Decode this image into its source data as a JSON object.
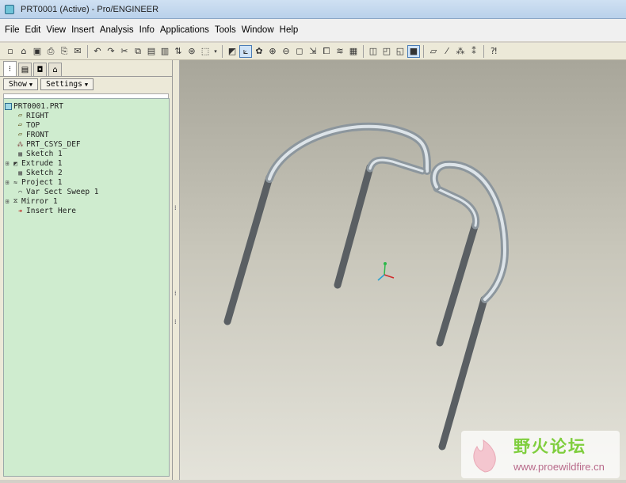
{
  "window": {
    "title": "PRT0001 (Active) - Pro/ENGINEER"
  },
  "menubar": {
    "items": [
      "File",
      "Edit",
      "View",
      "Insert",
      "Analysis",
      "Info",
      "Applications",
      "Tools",
      "Window",
      "Help"
    ]
  },
  "toolbar": {
    "buttons": [
      "new-icon",
      "open-icon",
      "save-icon",
      "print-icon",
      "print-preview-icon",
      "email-icon",
      "undo-icon",
      "redo-icon",
      "cut-icon",
      "copy-icon",
      "paste-icon",
      "paste-special-icon",
      "regenerate-icon",
      "find-icon",
      "select-box-icon",
      "repaint-icon",
      "spin-center-icon",
      "orient-mode-icon",
      "zoom-in-icon",
      "zoom-out-icon",
      "refit-icon",
      "reorient-icon",
      "saved-views-icon",
      "layers-icon",
      "view-manager-icon",
      "wireframe-icon",
      "hidden-line-icon",
      "no-hidden-icon",
      "shading-icon",
      "datum-planes-icon",
      "datum-axes-icon",
      "datum-points-icon",
      "coordinate-systems-icon",
      "context-help-icon"
    ]
  },
  "panel": {
    "tabs": [
      "model-tree-tab",
      "folder-browser-tab",
      "favorites-tab",
      "connections-tab"
    ],
    "show_label": "Show",
    "settings_label": "Settings"
  },
  "model_tree": {
    "items": [
      {
        "label": "PRT0001.PRT",
        "icon": "part-icon",
        "expandable": false,
        "indent": 0
      },
      {
        "label": "RIGHT",
        "icon": "datum-plane-icon",
        "expandable": false,
        "indent": 1
      },
      {
        "label": "TOP",
        "icon": "datum-plane-icon",
        "expandable": false,
        "indent": 1
      },
      {
        "label": "FRONT",
        "icon": "datum-plane-icon",
        "expandable": false,
        "indent": 1
      },
      {
        "label": "PRT_CSYS_DEF",
        "icon": "csys-icon",
        "expandable": false,
        "indent": 1
      },
      {
        "label": "Sketch 1",
        "icon": "sketch-icon",
        "expandable": false,
        "indent": 1
      },
      {
        "label": "Extrude 1",
        "icon": "extrude-icon",
        "expandable": true,
        "indent": 1
      },
      {
        "label": "Sketch 2",
        "icon": "sketch-icon",
        "expandable": false,
        "indent": 1
      },
      {
        "label": "Project 1",
        "icon": "project-icon",
        "expandable": true,
        "indent": 1
      },
      {
        "label": "Var Sect Sweep 1",
        "icon": "sweep-icon",
        "expandable": false,
        "indent": 1
      },
      {
        "label": "Mirror 1",
        "icon": "mirror-icon",
        "expandable": true,
        "indent": 1
      },
      {
        "label": "Insert Here",
        "icon": "insert-here-icon",
        "expandable": false,
        "indent": 1
      }
    ]
  },
  "watermark": {
    "cn": "野火论坛",
    "url": "www.proewildfire.cn"
  },
  "colors": {
    "tree_bg": "#cfeccf",
    "model_tube": "#5a5f63",
    "view_top": "#a8a69a",
    "view_bottom": "#e4e3da"
  }
}
